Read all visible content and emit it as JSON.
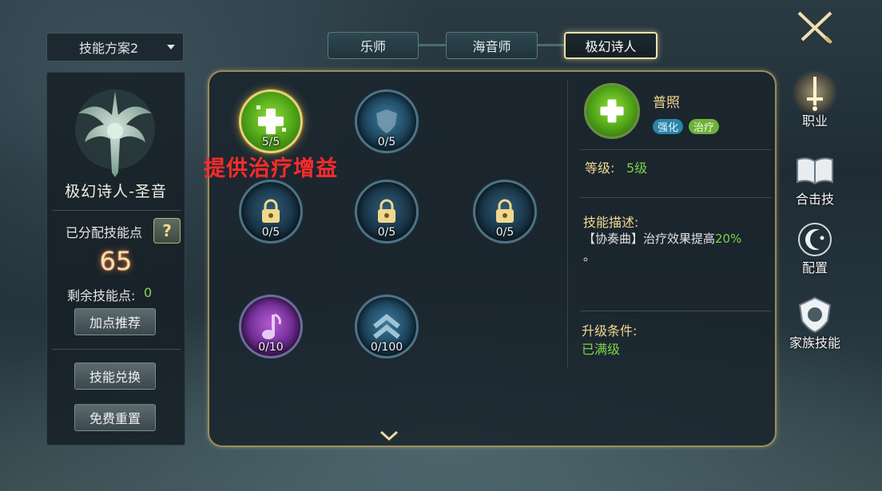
{
  "plan_selector": {
    "label": "技能方案2"
  },
  "tabs": [
    {
      "label": "乐师",
      "active": false
    },
    {
      "label": "海音师",
      "active": false
    },
    {
      "label": "极幻诗人",
      "active": true
    }
  ],
  "left_panel": {
    "class_name": "极幻诗人-圣音",
    "allocated_label": "已分配技能点",
    "help_label": "?",
    "allocated_points": "65",
    "remaining_label": "剩余技能点:",
    "remaining_value": "0",
    "recommend_button": "加点推荐",
    "exchange_button": "技能兑换",
    "reset_button": "免费重置"
  },
  "skills": [
    {
      "level": "5/5",
      "icon": "heal-cross-icon",
      "state": "active"
    },
    {
      "level": "0/5",
      "icon": "shield-icon",
      "state": "normal"
    },
    {
      "level": "0/5",
      "icon": "lock-icon",
      "state": "locked"
    },
    {
      "level": "0/5",
      "icon": "lock-icon",
      "state": "locked"
    },
    {
      "level": "0/5",
      "icon": "lock-icon",
      "state": "locked"
    },
    {
      "level": "0/10",
      "icon": "music-note-icon",
      "state": "normal"
    },
    {
      "level": "0/100",
      "icon": "double-chevron-up-icon",
      "state": "normal"
    }
  ],
  "annotation": "提供治疗增益",
  "detail": {
    "name": "普照",
    "tags": [
      "强化",
      "治疗"
    ],
    "level_label": "等级:",
    "level_value": "5级",
    "desc_label": "技能描述:",
    "desc_prefix": "【协奏曲】治疗效果提高",
    "desc_highlight": "20%",
    "desc_suffix": "。",
    "cond_label": "升级条件:",
    "cond_value": "已满级"
  },
  "nav": [
    {
      "label": "",
      "icon": "crossed-swords-icon"
    },
    {
      "label": "职业",
      "icon": "sword-emblem-icon",
      "active": true
    },
    {
      "label": "合击技",
      "icon": "book-icon"
    },
    {
      "label": "配置",
      "icon": "moon-star-icon"
    },
    {
      "label": "家族技能",
      "icon": "lion-crest-icon"
    }
  ],
  "colors": {
    "accent_gold": "#efe2a6",
    "heal_green": "#7fd04a",
    "note_red": "#ff2b2b",
    "points_glow": "#ff8a3c"
  }
}
